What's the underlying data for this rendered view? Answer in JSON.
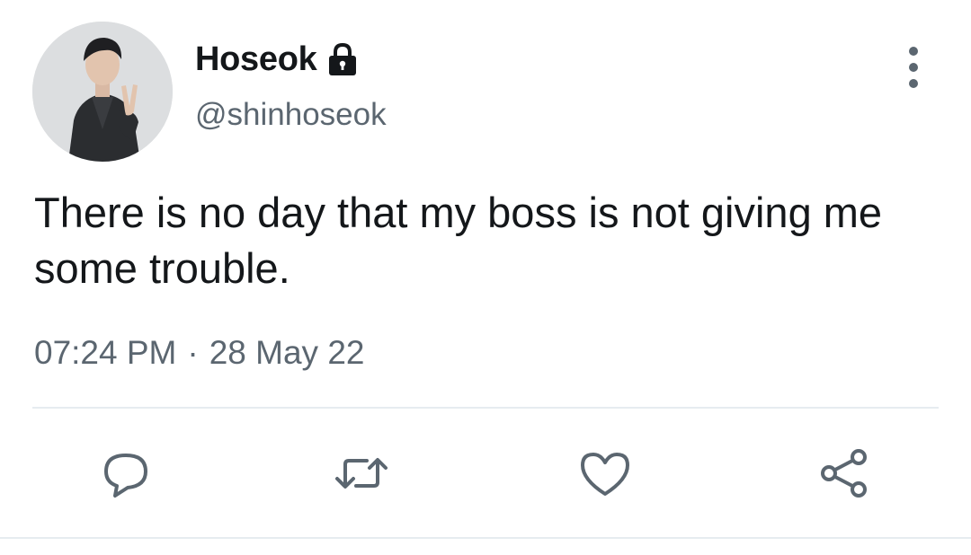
{
  "tweet": {
    "display_name": "Hoseok",
    "handle": "@shinhoseok",
    "protected_icon": "lock-icon",
    "text": "There is no day that my boss is not giving me some trouble.",
    "time": "07:24 PM",
    "separator": "·",
    "date": "28 May 22"
  },
  "actions": [
    {
      "name": "reply",
      "icon": "reply-icon"
    },
    {
      "name": "retweet",
      "icon": "retweet-icon"
    },
    {
      "name": "like",
      "icon": "heart-icon"
    },
    {
      "name": "share",
      "icon": "share-icon"
    }
  ],
  "colors": {
    "text": "#14171a",
    "secondary": "#5b6670",
    "divider": "#e6ecf0",
    "background": "#ffffff"
  }
}
